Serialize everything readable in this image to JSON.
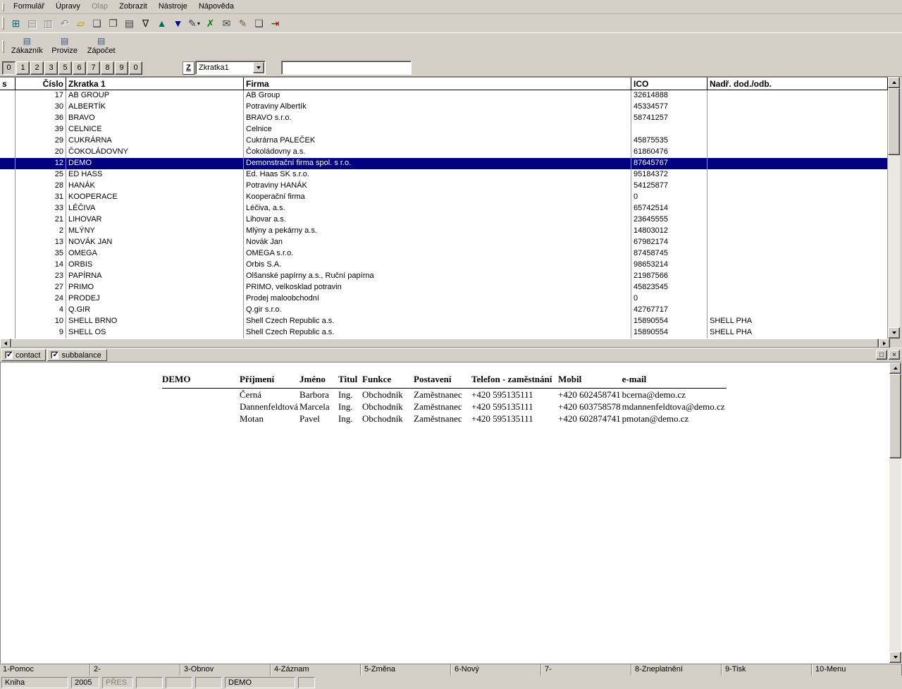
{
  "menu": {
    "items": [
      {
        "label": "Formulář",
        "enabled": true
      },
      {
        "label": "Úpravy",
        "enabled": true
      },
      {
        "label": "Olap",
        "enabled": false
      },
      {
        "label": "Zobrazit",
        "enabled": true
      },
      {
        "label": "Nástroje",
        "enabled": true
      },
      {
        "label": "Nápověda",
        "enabled": true
      }
    ]
  },
  "toolbar": {
    "icons": [
      {
        "name": "new-record-icon",
        "glyph": "⊞",
        "color": "#007070",
        "enabled": true
      },
      {
        "name": "save-icon",
        "glyph": "▤",
        "color": "#808080",
        "enabled": false
      },
      {
        "name": "save-as-icon",
        "glyph": "▥",
        "color": "#808080",
        "enabled": false
      },
      {
        "name": "undo-icon",
        "glyph": "↶",
        "color": "#808080",
        "enabled": false
      },
      {
        "name": "open-folder-icon",
        "glyph": "▱",
        "color": "#b8860b",
        "enabled": true
      },
      {
        "name": "new-document-icon",
        "glyph": "❏",
        "color": "#404040",
        "enabled": true
      },
      {
        "name": "copy-icon",
        "glyph": "❐",
        "color": "#404040",
        "enabled": true
      },
      {
        "name": "pages-icon",
        "glyph": "▤",
        "color": "#404040",
        "enabled": true
      },
      {
        "name": "filter-icon",
        "glyph": "∇",
        "color": "#202020",
        "enabled": true
      },
      {
        "name": "sort-up-icon",
        "glyph": "▲",
        "color": "#006666",
        "enabled": true
      },
      {
        "name": "sort-down-icon",
        "glyph": "▼",
        "color": "#000099",
        "enabled": true
      },
      {
        "name": "edit-dropdown-icon",
        "glyph": "✎",
        "color": "#404040",
        "enabled": true,
        "dropdown": true
      },
      {
        "name": "export-excel-icon",
        "glyph": "✗",
        "color": "#008000",
        "enabled": true
      },
      {
        "name": "mail-icon",
        "glyph": "✉",
        "color": "#404040",
        "enabled": true
      },
      {
        "name": "edit-page-icon",
        "glyph": "✎",
        "color": "#806040",
        "enabled": true
      },
      {
        "name": "attach-icon",
        "glyph": "❑",
        "color": "#404040",
        "enabled": true
      },
      {
        "name": "exit-icon",
        "glyph": "⇥",
        "color": "#aa0000",
        "enabled": true
      }
    ]
  },
  "shortcut_buttons": [
    {
      "name": "zakaznik-button",
      "label": "Zákazník",
      "glyph": "▤"
    },
    {
      "name": "provize-button",
      "label": "Provize",
      "glyph": "▤"
    },
    {
      "name": "zapocet-button",
      "label": "Zápočet",
      "glyph": "▤"
    }
  ],
  "filter_bar": {
    "digits": [
      "0",
      "1",
      "2",
      "3",
      "5",
      "6",
      "7",
      "8",
      "9",
      "0"
    ],
    "pressed_index": 0,
    "z_button": "Z",
    "sort_combo_value": "Zkratka1",
    "search_value": ""
  },
  "grid": {
    "columns": [
      {
        "label": "s",
        "align": "left"
      },
      {
        "label": "Číslo",
        "align": "right"
      },
      {
        "label": "Zkratka 1",
        "align": "left"
      },
      {
        "label": "Firma",
        "align": "left"
      },
      {
        "label": "ICO",
        "align": "left"
      },
      {
        "label": "Nadř. dod./odb.",
        "align": "left"
      }
    ],
    "selected_index": 6,
    "rows": [
      [
        "",
        "17",
        "AB GROUP",
        "AB Group",
        "32614888",
        ""
      ],
      [
        "",
        "30",
        "ALBERTÍK",
        "Potraviny Albertík",
        "45334577",
        ""
      ],
      [
        "",
        "36",
        "BRAVO",
        "BRAVO s.r.o.",
        "58741257",
        ""
      ],
      [
        "",
        "39",
        "CELNICE",
        "Celnice",
        "",
        ""
      ],
      [
        "",
        "29",
        "CUKRÁRNA",
        "Cukrárna PALEČEK",
        "45875535",
        ""
      ],
      [
        "",
        "20",
        "ČOKOLÁDOVNY",
        "Čokoládovny a.s.",
        "61860476",
        ""
      ],
      [
        "",
        "12",
        "DEMO",
        "Demonstrační firma spol. s r.o.",
        "87645767",
        ""
      ],
      [
        "",
        "25",
        "ED HASS",
        "Ed. Haas SK s.r.o.",
        "95184372",
        ""
      ],
      [
        "",
        "28",
        "HANÁK",
        "Potraviny HANÁK",
        "54125877",
        ""
      ],
      [
        "",
        "31",
        "KOOPERACE",
        "Kooperační firma",
        "0",
        ""
      ],
      [
        "",
        "33",
        "LÉČIVA",
        "Léčiva, a.s.",
        "65742514",
        ""
      ],
      [
        "",
        "21",
        "LIHOVAR",
        "Lihovar a.s.",
        "23645555",
        ""
      ],
      [
        "",
        "2",
        "MLÝNY",
        "Mlýny a pekárny a.s.",
        "14803012",
        ""
      ],
      [
        "",
        "13",
        "NOVÁK JAN",
        "Novák Jan",
        "67982174",
        ""
      ],
      [
        "",
        "35",
        "OMEGA",
        "OMEGA s.r.o.",
        "87458745",
        ""
      ],
      [
        "",
        "14",
        "ORBIS",
        "Orbis S.A.",
        "98653214",
        ""
      ],
      [
        "",
        "23",
        "PAPÍRNA",
        "Olšanské papírny a.s., Ruční papírna",
        "21987566",
        ""
      ],
      [
        "",
        "27",
        "PRIMO",
        "PRIMO, velkosklad potravin",
        "45823545",
        ""
      ],
      [
        "",
        "24",
        "PRODEJ",
        "Prodej maloobchodní",
        "0",
        ""
      ],
      [
        "",
        "4",
        "Q.GIR",
        "Q.gir s.r.o.",
        "42767717",
        ""
      ],
      [
        "",
        "10",
        "SHELL BRNO",
        "Shell Czech Republic a.s.",
        "15890554",
        "SHELL PHA"
      ],
      [
        "",
        "9",
        "SHELL OS",
        "Shell Czech Republic a.s.",
        "15890554",
        "SHELL PHA"
      ]
    ]
  },
  "detail": {
    "tabs": [
      {
        "label": "contact",
        "checked": true
      },
      {
        "label": "subbalance",
        "checked": true
      }
    ],
    "window_buttons": [
      {
        "name": "detail-restore-button",
        "glyph": "□"
      },
      {
        "name": "detail-close-button",
        "glyph": "×"
      }
    ],
    "title": "DEMO",
    "columns": [
      "Příjmení",
      "Jméno",
      "Titul",
      "Funkce",
      "Postavení",
      "Telefon - zaměstnání",
      "Mobil",
      "e-mail"
    ],
    "rows": [
      [
        "Černá",
        "Barbora",
        "Ing.",
        "Obchodník",
        "Zaměstnanec",
        "+420 595135111",
        "+420 602458741",
        "bcerna@demo.cz"
      ],
      [
        "Dannenfeldtová",
        "Marcela",
        "Ing.",
        "Obchodník",
        "Zaměstnanec",
        "+420 595135111",
        "+420 603758578",
        "mdannenfeldtova@demo.cz"
      ],
      [
        "Motan",
        "Pavel",
        "Ing.",
        "Obchodník",
        "Zaměstnanec",
        "+420 595135111",
        "+420 602874741",
        "pmotan@demo.cz"
      ]
    ]
  },
  "function_bar": [
    "1-Pomoc",
    "2-",
    "3-Obnov",
    "4-Záznam",
    "5-Změna",
    "6-Nový",
    "7-",
    "8-Zneplatnění",
    "9-Tisk",
    "10-Menu"
  ],
  "status_bar": {
    "cells": [
      {
        "label": "Kniha",
        "muted": false
      },
      {
        "label": "2005",
        "muted": false
      },
      {
        "label": "PŘES",
        "muted": true
      },
      {
        "label": "",
        "muted": false
      },
      {
        "label": "",
        "muted": false
      },
      {
        "label": "",
        "muted": false
      },
      {
        "label": "DEMO",
        "muted": false
      },
      {
        "label": "",
        "muted": false
      }
    ]
  }
}
